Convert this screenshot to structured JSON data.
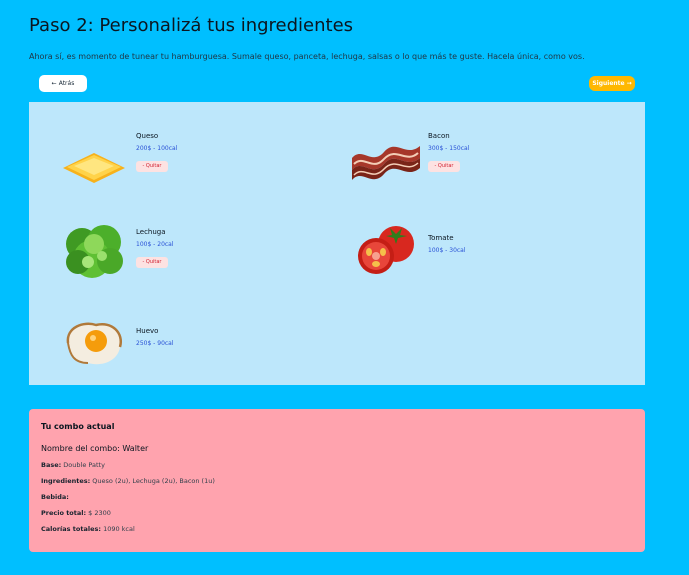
{
  "page": {
    "title": "Paso 2: Personalizá tus ingredientes",
    "subtitle": "Ahora sí, es momento de tunear tu hamburguesa. Sumale queso, panceta, lechuga, salsas o lo que más te guste. Hacela única, como vos."
  },
  "nav": {
    "back_label": "Atrás",
    "back_icon": "←",
    "next_label": "Siguiente",
    "next_icon": "→"
  },
  "ingredients": [
    {
      "name": "Queso",
      "meta": "200$ - 100cal",
      "remove_label": "- Quitar",
      "icon": "cheese-icon"
    },
    {
      "name": "Bacon",
      "meta": "300$ - 150cal",
      "remove_label": "- Quitar",
      "icon": "bacon-icon"
    },
    {
      "name": "Lechuga",
      "meta": "100$ - 20cal",
      "remove_label": "- Quitar",
      "icon": "lettuce-icon"
    },
    {
      "name": "Tomate",
      "meta": "100$ - 30cal",
      "icon": "tomato-icon"
    },
    {
      "name": "Huevo",
      "meta": "250$ - 90cal",
      "icon": "egg-icon"
    }
  ],
  "summary": {
    "heading": "Tu combo actual",
    "combo_label": "Nombre del combo:",
    "combo_name": "Walter",
    "base_label": "Base:",
    "base_value": "Double Patty",
    "ingredients_label": "Ingredientes:",
    "ingredients_value": "Queso (2u), Lechuga (2u), Bacon (1u)",
    "drink_label": "Bebida:",
    "drink_value": "",
    "price_label": "Precio total:",
    "price_value": "$ 2300",
    "calories_label": "Calorías totales:",
    "calories_value": "1090 kcal"
  },
  "colors": {
    "page_bg": "#00bfff",
    "grid_bg": "#bde7fb",
    "summary_bg": "#ffa3ae",
    "next_button": "#ffb800",
    "price_text": "#2a52d6",
    "remove_text": "#d01f2f"
  }
}
